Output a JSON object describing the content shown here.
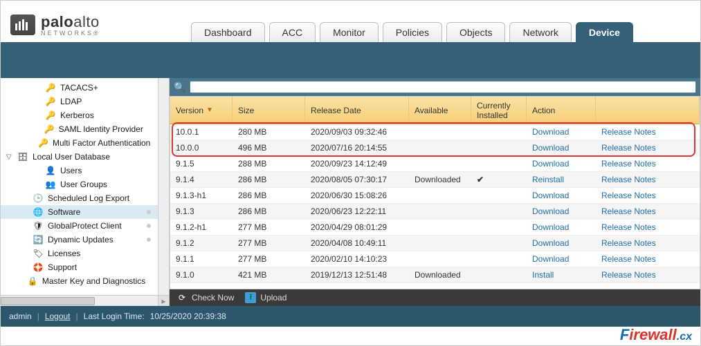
{
  "brand": {
    "name_bold": "palo",
    "name_rest": "alto",
    "sub": "NETWORKS®"
  },
  "tabs": [
    {
      "label": "Dashboard"
    },
    {
      "label": "ACC"
    },
    {
      "label": "Monitor"
    },
    {
      "label": "Policies"
    },
    {
      "label": "Objects"
    },
    {
      "label": "Network"
    },
    {
      "label": "Device",
      "active": true
    }
  ],
  "sidebar": {
    "items": [
      {
        "label": "TACACS+",
        "indent": 2,
        "icon": "key-icon"
      },
      {
        "label": "LDAP",
        "indent": 2,
        "icon": "key-icon"
      },
      {
        "label": "Kerberos",
        "indent": 2,
        "icon": "key-icon"
      },
      {
        "label": "SAML Identity Provider",
        "indent": 2,
        "icon": "key-icon"
      },
      {
        "label": "Multi Factor Authentication",
        "indent": 2,
        "icon": "key-icon"
      },
      {
        "label": "Local User Database",
        "indent": 0,
        "icon": "db-icon",
        "caret": "▽"
      },
      {
        "label": "Users",
        "indent": 2,
        "icon": "user-icon"
      },
      {
        "label": "User Groups",
        "indent": 2,
        "icon": "group-icon"
      },
      {
        "label": "Scheduled Log Export",
        "indent": 1,
        "icon": "clock-icon"
      },
      {
        "label": "Software",
        "indent": 1,
        "icon": "globe-icon",
        "selected": true,
        "dot": true
      },
      {
        "label": "GlobalProtect Client",
        "indent": 1,
        "icon": "shield-icon",
        "dot": true
      },
      {
        "label": "Dynamic Updates",
        "indent": 1,
        "icon": "refresh-icon",
        "dot": true
      },
      {
        "label": "Licenses",
        "indent": 1,
        "icon": "license-icon"
      },
      {
        "label": "Support",
        "indent": 1,
        "icon": "support-icon"
      },
      {
        "label": "Master Key and Diagnostics",
        "indent": 1,
        "icon": "lock-icon"
      }
    ]
  },
  "search": {
    "placeholder": ""
  },
  "columns": {
    "version": "Version",
    "size": "Size",
    "date": "Release Date",
    "avail": "Available",
    "inst": "Currently Installed",
    "action": "Action",
    "notes": ""
  },
  "rows": [
    {
      "version": "10.0.1",
      "size": "280 MB",
      "date": "2020/09/03 09:32:46",
      "avail": "",
      "inst": "",
      "action": "Download",
      "notes": "Release Notes",
      "hl": true
    },
    {
      "version": "10.0.0",
      "size": "496 MB",
      "date": "2020/07/16 20:14:55",
      "avail": "",
      "inst": "",
      "action": "Download",
      "notes": "Release Notes",
      "hl": true
    },
    {
      "version": "9.1.5",
      "size": "288 MB",
      "date": "2020/09/23 14:12:49",
      "avail": "",
      "inst": "",
      "action": "Download",
      "notes": "Release Notes"
    },
    {
      "version": "9.1.4",
      "size": "286 MB",
      "date": "2020/08/05 07:30:17",
      "avail": "Downloaded",
      "inst": "✓",
      "action": "Reinstall",
      "notes": "Release Notes"
    },
    {
      "version": "9.1.3-h1",
      "size": "286 MB",
      "date": "2020/06/30 15:08:26",
      "avail": "",
      "inst": "",
      "action": "Download",
      "notes": "Release Notes"
    },
    {
      "version": "9.1.3",
      "size": "286 MB",
      "date": "2020/06/23 12:22:11",
      "avail": "",
      "inst": "",
      "action": "Download",
      "notes": "Release Notes"
    },
    {
      "version": "9.1.2-h1",
      "size": "277 MB",
      "date": "2020/04/29 08:01:29",
      "avail": "",
      "inst": "",
      "action": "Download",
      "notes": "Release Notes"
    },
    {
      "version": "9.1.2",
      "size": "277 MB",
      "date": "2020/04/08 10:49:11",
      "avail": "",
      "inst": "",
      "action": "Download",
      "notes": "Release Notes"
    },
    {
      "version": "9.1.1",
      "size": "277 MB",
      "date": "2020/02/10 14:10:23",
      "avail": "",
      "inst": "",
      "action": "Download",
      "notes": "Release Notes"
    },
    {
      "version": "9.1.0",
      "size": "421 MB",
      "date": "2019/12/13 12:51:48",
      "avail": "Downloaded",
      "inst": "",
      "action": "Install",
      "notes": "Release Notes"
    }
  ],
  "toolbar": {
    "check": "Check Now",
    "upload": "Upload"
  },
  "footer": {
    "user": "admin",
    "logout": "Logout",
    "login_label": "Last Login Time:",
    "login_time": "10/25/2020 20:39:38"
  },
  "watermark": {
    "a": "F",
    "b": "irewall",
    "c": ".cx"
  }
}
